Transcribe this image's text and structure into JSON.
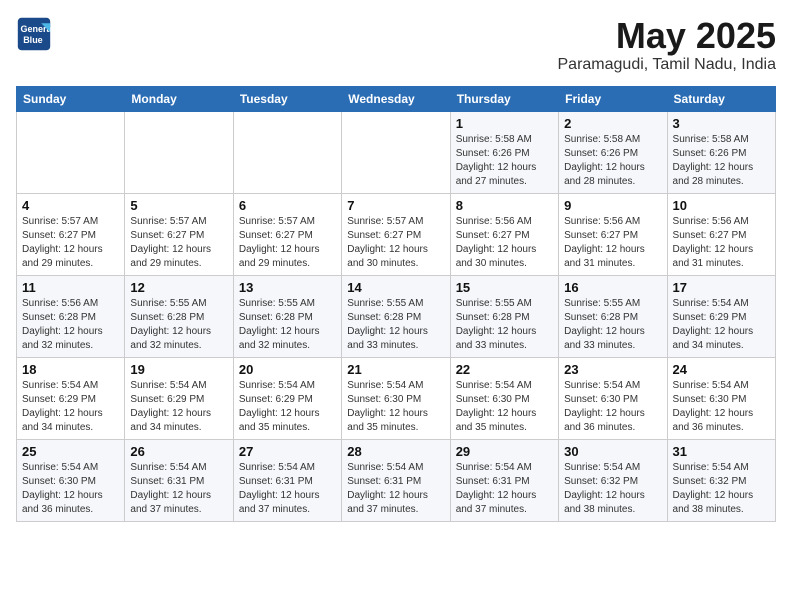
{
  "logo": {
    "line1": "General",
    "line2": "Blue"
  },
  "title": "May 2025",
  "location": "Paramagudi, Tamil Nadu, India",
  "days_of_week": [
    "Sunday",
    "Monday",
    "Tuesday",
    "Wednesday",
    "Thursday",
    "Friday",
    "Saturday"
  ],
  "weeks": [
    [
      {
        "day": "",
        "info": ""
      },
      {
        "day": "",
        "info": ""
      },
      {
        "day": "",
        "info": ""
      },
      {
        "day": "",
        "info": ""
      },
      {
        "day": "1",
        "info": "Sunrise: 5:58 AM\nSunset: 6:26 PM\nDaylight: 12 hours\nand 27 minutes."
      },
      {
        "day": "2",
        "info": "Sunrise: 5:58 AM\nSunset: 6:26 PM\nDaylight: 12 hours\nand 28 minutes."
      },
      {
        "day": "3",
        "info": "Sunrise: 5:58 AM\nSunset: 6:26 PM\nDaylight: 12 hours\nand 28 minutes."
      }
    ],
    [
      {
        "day": "4",
        "info": "Sunrise: 5:57 AM\nSunset: 6:27 PM\nDaylight: 12 hours\nand 29 minutes."
      },
      {
        "day": "5",
        "info": "Sunrise: 5:57 AM\nSunset: 6:27 PM\nDaylight: 12 hours\nand 29 minutes."
      },
      {
        "day": "6",
        "info": "Sunrise: 5:57 AM\nSunset: 6:27 PM\nDaylight: 12 hours\nand 29 minutes."
      },
      {
        "day": "7",
        "info": "Sunrise: 5:57 AM\nSunset: 6:27 PM\nDaylight: 12 hours\nand 30 minutes."
      },
      {
        "day": "8",
        "info": "Sunrise: 5:56 AM\nSunset: 6:27 PM\nDaylight: 12 hours\nand 30 minutes."
      },
      {
        "day": "9",
        "info": "Sunrise: 5:56 AM\nSunset: 6:27 PM\nDaylight: 12 hours\nand 31 minutes."
      },
      {
        "day": "10",
        "info": "Sunrise: 5:56 AM\nSunset: 6:27 PM\nDaylight: 12 hours\nand 31 minutes."
      }
    ],
    [
      {
        "day": "11",
        "info": "Sunrise: 5:56 AM\nSunset: 6:28 PM\nDaylight: 12 hours\nand 32 minutes."
      },
      {
        "day": "12",
        "info": "Sunrise: 5:55 AM\nSunset: 6:28 PM\nDaylight: 12 hours\nand 32 minutes."
      },
      {
        "day": "13",
        "info": "Sunrise: 5:55 AM\nSunset: 6:28 PM\nDaylight: 12 hours\nand 32 minutes."
      },
      {
        "day": "14",
        "info": "Sunrise: 5:55 AM\nSunset: 6:28 PM\nDaylight: 12 hours\nand 33 minutes."
      },
      {
        "day": "15",
        "info": "Sunrise: 5:55 AM\nSunset: 6:28 PM\nDaylight: 12 hours\nand 33 minutes."
      },
      {
        "day": "16",
        "info": "Sunrise: 5:55 AM\nSunset: 6:28 PM\nDaylight: 12 hours\nand 33 minutes."
      },
      {
        "day": "17",
        "info": "Sunrise: 5:54 AM\nSunset: 6:29 PM\nDaylight: 12 hours\nand 34 minutes."
      }
    ],
    [
      {
        "day": "18",
        "info": "Sunrise: 5:54 AM\nSunset: 6:29 PM\nDaylight: 12 hours\nand 34 minutes."
      },
      {
        "day": "19",
        "info": "Sunrise: 5:54 AM\nSunset: 6:29 PM\nDaylight: 12 hours\nand 34 minutes."
      },
      {
        "day": "20",
        "info": "Sunrise: 5:54 AM\nSunset: 6:29 PM\nDaylight: 12 hours\nand 35 minutes."
      },
      {
        "day": "21",
        "info": "Sunrise: 5:54 AM\nSunset: 6:30 PM\nDaylight: 12 hours\nand 35 minutes."
      },
      {
        "day": "22",
        "info": "Sunrise: 5:54 AM\nSunset: 6:30 PM\nDaylight: 12 hours\nand 35 minutes."
      },
      {
        "day": "23",
        "info": "Sunrise: 5:54 AM\nSunset: 6:30 PM\nDaylight: 12 hours\nand 36 minutes."
      },
      {
        "day": "24",
        "info": "Sunrise: 5:54 AM\nSunset: 6:30 PM\nDaylight: 12 hours\nand 36 minutes."
      }
    ],
    [
      {
        "day": "25",
        "info": "Sunrise: 5:54 AM\nSunset: 6:30 PM\nDaylight: 12 hours\nand 36 minutes."
      },
      {
        "day": "26",
        "info": "Sunrise: 5:54 AM\nSunset: 6:31 PM\nDaylight: 12 hours\nand 37 minutes."
      },
      {
        "day": "27",
        "info": "Sunrise: 5:54 AM\nSunset: 6:31 PM\nDaylight: 12 hours\nand 37 minutes."
      },
      {
        "day": "28",
        "info": "Sunrise: 5:54 AM\nSunset: 6:31 PM\nDaylight: 12 hours\nand 37 minutes."
      },
      {
        "day": "29",
        "info": "Sunrise: 5:54 AM\nSunset: 6:31 PM\nDaylight: 12 hours\nand 37 minutes."
      },
      {
        "day": "30",
        "info": "Sunrise: 5:54 AM\nSunset: 6:32 PM\nDaylight: 12 hours\nand 38 minutes."
      },
      {
        "day": "31",
        "info": "Sunrise: 5:54 AM\nSunset: 6:32 PM\nDaylight: 12 hours\nand 38 minutes."
      }
    ]
  ]
}
